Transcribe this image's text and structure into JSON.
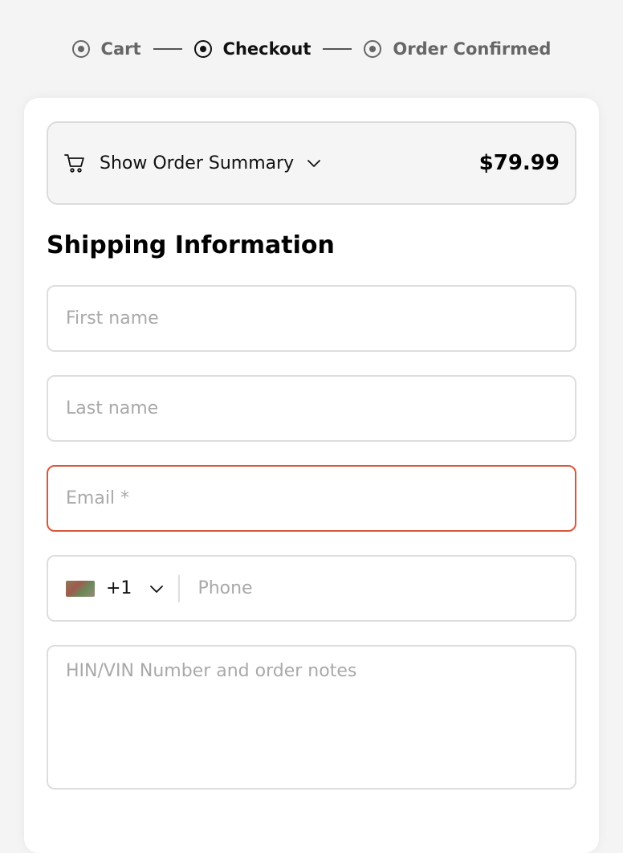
{
  "stepper": {
    "steps": [
      {
        "label": "Cart",
        "active": false
      },
      {
        "label": "Checkout",
        "active": true
      },
      {
        "label": "Order Confirmed",
        "active": false
      }
    ]
  },
  "order_summary": {
    "label": "Show Order Summary",
    "total": "$79.99",
    "icons": {
      "cart": "cart-icon",
      "toggle": "chevron-down-icon"
    }
  },
  "shipping": {
    "title": "Shipping Information",
    "first_name": {
      "value": "",
      "placeholder": "First name"
    },
    "last_name": {
      "value": "",
      "placeholder": "Last name"
    },
    "email": {
      "value": "",
      "placeholder": "Email *",
      "state": "error"
    },
    "phone": {
      "country_code": "+1",
      "value": "",
      "placeholder": "Phone"
    },
    "notes": {
      "value": "",
      "placeholder": "HIN/VIN Number and order notes"
    }
  },
  "colors": {
    "background": "#f4f4f4",
    "card": "#ffffff",
    "error_border": "#d9573c",
    "field_border": "#dedede",
    "placeholder": "#a9a9a9"
  }
}
